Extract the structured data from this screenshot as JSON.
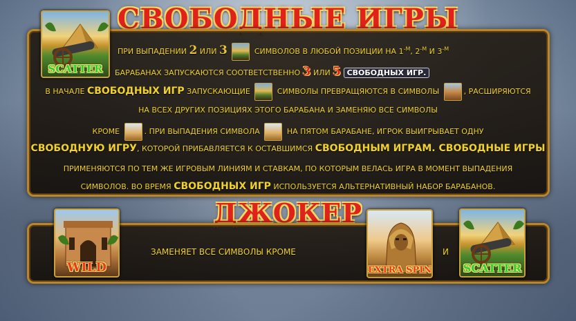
{
  "titles": {
    "free_games": "СВОБОДНЫЕ ИГРЫ",
    "joker": "ДЖОКЕР"
  },
  "symbols": {
    "scatter_label": "SCATTER",
    "wild_label": "WILD",
    "extra_spin_label": "EXTRA SPIN",
    "scatter_icon": "cannon-pyramid-icon",
    "wild_icon": "triumphal-arch-icon",
    "extra_spin_icon": "sphinx-icon"
  },
  "free_games": {
    "line1_a": "При выпадении",
    "line1_n2": "2",
    "line1_or": "или",
    "line1_n3": "3",
    "line1_b": "символов в любой позиции на",
    "line1_r1": "1",
    "line1_r1_sup": "-м",
    "line1_r2": "2",
    "line1_r2_sup": "-м",
    "line1_and": "и",
    "line1_r3": "3",
    "line1_r3_sup": "-м",
    "line2_a": "барабанах запускаются соответственно",
    "line2_n3": "3",
    "line2_or": "или",
    "line2_n5": "5",
    "line2_highlight": "свободных игр.",
    "line3_a": "В начале",
    "line3_big": "свободных игр",
    "line3_b": "запускающие",
    "line3_c": "символы превращяются в символы",
    "line3_d": ", расширяются",
    "line4": "на всех других позициях этого барабана и заменяю все символы",
    "line5_a": "кроме",
    "line5_b": ". При выпадения символа",
    "line5_c": "на пятом барабане, игрок выигрывает одну",
    "line6_big1": "свободную игру",
    "line6_a": ", которой прибавляется к оставшимся",
    "line6_big2": "свободным играм. Свободные игры",
    "line7": "применяются по тем же игровым линиям и ставкам, по которым велась игра в момент выпадения",
    "line8_a": "символов. Во время",
    "line8_big": "свободных игр",
    "line8_b": "используется альтернативный набор барабанов."
  },
  "joker": {
    "description": "заменяет все символы кроме",
    "and": "и"
  },
  "colors": {
    "title_red": "#e0231a",
    "text_gold": "#f0d12e",
    "frame_gold": "#b9862a"
  }
}
